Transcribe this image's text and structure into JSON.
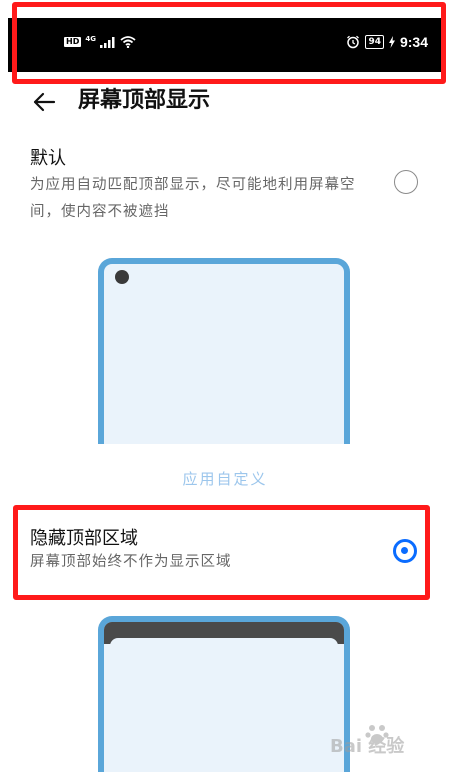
{
  "status_bar": {
    "hd_label": "HD",
    "network_label": "4G",
    "battery_level": "94",
    "time": "9:34",
    "icons": [
      "hd-icon",
      "signal-icon",
      "wifi-icon",
      "alarm-icon",
      "battery-icon",
      "charging-icon"
    ]
  },
  "header": {
    "title": "屏幕顶部显示",
    "back_icon": "arrow-left-icon"
  },
  "options": [
    {
      "title": "默认",
      "description": "为应用自动匹配顶部显示，尽可能地利用屏幕空间，使内容不被遮挡",
      "selected": false
    },
    {
      "title": "隐藏顶部区域",
      "description": "屏幕顶部始终不作为显示区域",
      "selected": true
    }
  ],
  "section_label": "应用自定义",
  "colors": {
    "accent": "#0a6cff",
    "phone_frame": "#5aa6d9",
    "phone_screen": "#eaf3fb",
    "highlight": "#ff1a1a",
    "section_label": "#9cc6ec"
  },
  "watermark": {
    "text": "Bai 经验",
    "logo_icon": "baidu-paw-icon"
  }
}
